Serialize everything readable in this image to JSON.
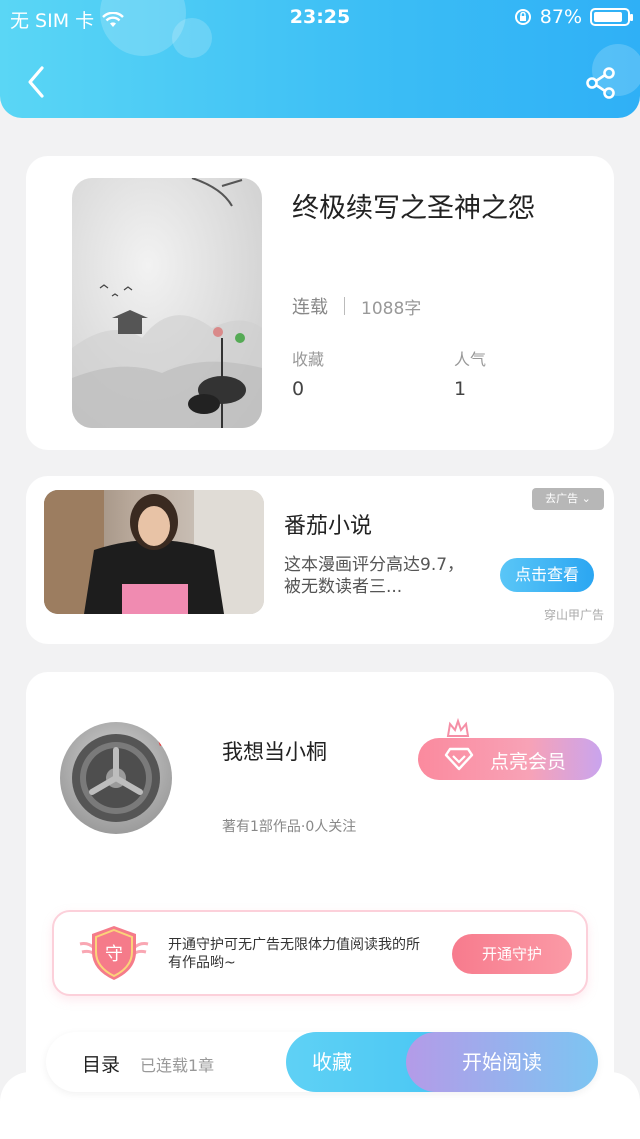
{
  "status_bar": {
    "carrier": "无 SIM 卡",
    "time": "23:25",
    "battery": "87%",
    "battery_level": 0.87
  },
  "header": {
    "back_icon": "chevron-left-icon",
    "share_icon": "share-icon"
  },
  "book": {
    "title": "终极续写之圣神之怨",
    "status": "连载",
    "word_count": "1088字",
    "stats": [
      {
        "label": "收藏",
        "value": "0"
      },
      {
        "label": "人气",
        "value": "1"
      }
    ]
  },
  "ad": {
    "title": "番茄小说",
    "description": "这本漫画评分高达9.7，被无数读者三...",
    "close_label": "去广告 ⌄",
    "button_label": "点击查看",
    "source": "穿山甲广告"
  },
  "author": {
    "name": "我想当小桐",
    "info": "著有1部作品·0人关注",
    "vip_label": "点亮会员",
    "guard_badge": "守",
    "guard_text": "开通守护可无广告无限体力值阅读我的所有作品哟~",
    "guard_button": "开通守护"
  },
  "bottom_bar": {
    "toc_label": "目录",
    "toc_status": "已连载1章",
    "favorite_label": "收藏",
    "read_label": "开始阅读"
  },
  "colors": {
    "header_blue": "#3bbdf5",
    "accent_pink": "#f77b8d",
    "accent_purple": "#b49be8"
  }
}
